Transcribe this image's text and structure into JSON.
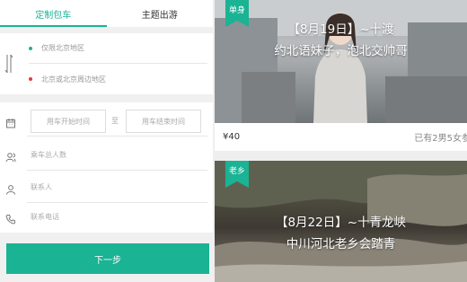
{
  "tabs": [
    {
      "label": "定制包车",
      "active": true
    },
    {
      "label": "主题出游",
      "active": false
    }
  ],
  "address": {
    "pickup_placeholder": "仅限北京地区",
    "dropoff_placeholder": "北京或北京周边地区",
    "pickup_dot_color": "#1ab394",
    "dropoff_dot_color": "#e8372e"
  },
  "form": {
    "start_time_placeholder": "用车开始时间",
    "separator": "至",
    "end_time_placeholder": "用车结束时间",
    "passengers_placeholder": "乘车总人数",
    "contact_placeholder": "联系人",
    "phone_placeholder": "联系电话"
  },
  "next_button": "下一步",
  "trips": [
    {
      "badge": "单身",
      "title_line1": "【8月19日】~十渡",
      "title_line2": "约北语妹子，泡北交帅哥",
      "price": "¥40",
      "joined": "已有2男5女参加"
    },
    {
      "badge": "老乡",
      "title_line1": "【8月22日】~十青龙峡",
      "title_line2": "中川河北老乡会踏青"
    }
  ],
  "colors": {
    "accent": "#1ab394",
    "alert": "#e8372e"
  }
}
